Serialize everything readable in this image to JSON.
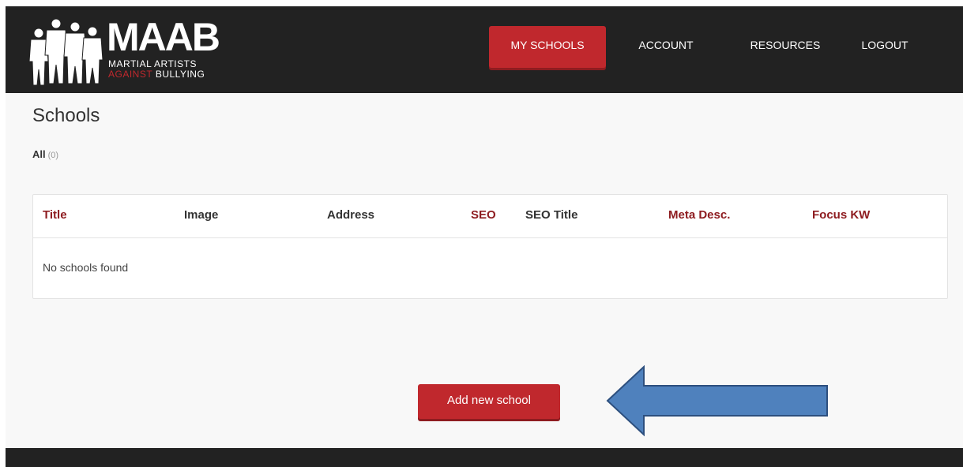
{
  "brand": {
    "letters": "MAAB",
    "line1": "MARTIAL ARTISTS",
    "line2_red": "AGAINST",
    "line2_white": "BULLYING",
    "accent_color": "#c0282d",
    "header_color": "#222222"
  },
  "nav": {
    "items": [
      {
        "label": "MY SCHOOLS",
        "active": true
      },
      {
        "label": "ACCOUNT"
      },
      {
        "label": "RESOURCES"
      },
      {
        "label": "LOGOUT"
      }
    ]
  },
  "page": {
    "title": "Schools",
    "filter_label": "All",
    "filter_count": "(0)"
  },
  "table": {
    "columns": [
      {
        "label": "Title",
        "sortable": true
      },
      {
        "label": "Image",
        "sortable": false
      },
      {
        "label": "Address",
        "sortable": false
      },
      {
        "label": "SEO",
        "sortable": true
      },
      {
        "label": "SEO Title",
        "sortable": false
      },
      {
        "label": "Meta Desc.",
        "sortable": true
      },
      {
        "label": "Focus KW",
        "sortable": true
      }
    ],
    "empty_message": "No schools found"
  },
  "actions": {
    "add_label": "Add new school"
  },
  "annotation": {
    "arrow_icon": "left-arrow-icon",
    "arrow_color": "#4f81bd"
  }
}
